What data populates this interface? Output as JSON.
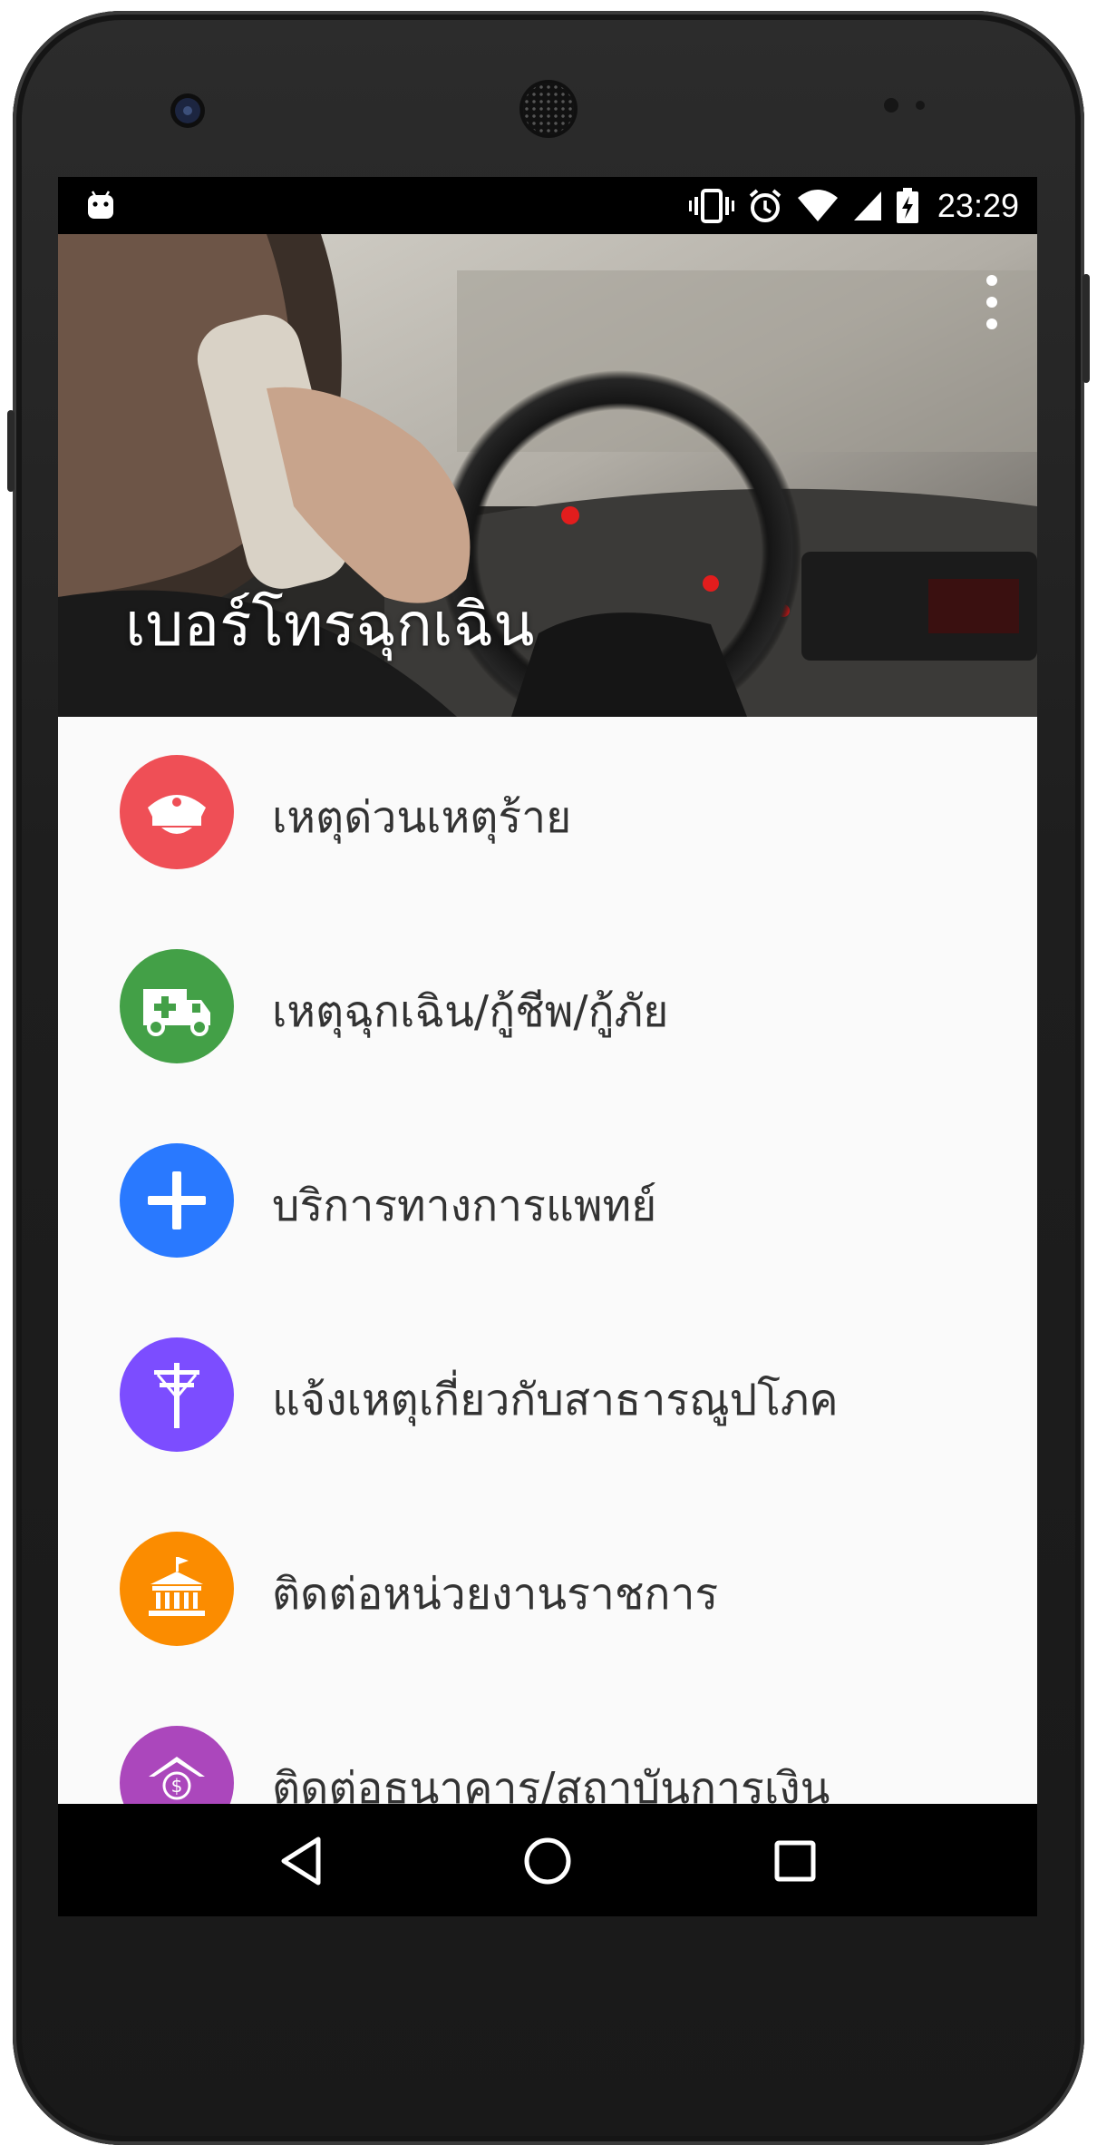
{
  "status_bar": {
    "time": "23:29",
    "icons": [
      "android-icon",
      "vibrate-icon",
      "alarm-icon",
      "wifi-icon",
      "cell-signal-icon",
      "battery-charging-icon"
    ]
  },
  "header": {
    "title": "เบอร์โทรฉุกเฉิน",
    "menu_icon": "overflow-menu-icon"
  },
  "categories": [
    {
      "label": "เหตุด่วนเหตุร้าย",
      "icon": "police-cap-icon",
      "color": "#ef4f56"
    },
    {
      "label": "เหตุฉุกเฉิน/กู้ชีพ/กู้ภัย",
      "icon": "ambulance-icon",
      "color": "#43a047"
    },
    {
      "label": "บริการทางการแพทย์",
      "icon": "medical-plus-icon",
      "color": "#2979ff"
    },
    {
      "label": "แจ้งเหตุเกี่ยวกับสาธารณูปโภค",
      "icon": "utility-pole-icon",
      "color": "#7c4dff"
    },
    {
      "label": "ติดต่อหน่วยงานราชการ",
      "icon": "government-building-icon",
      "color": "#fb8c00"
    },
    {
      "label": "ติดต่อธนาคาร/สถาบันการเงิน",
      "icon": "bank-icon",
      "color": "#ab47bc"
    }
  ],
  "nav_bar": {
    "icons": [
      "back-icon",
      "home-icon",
      "recents-icon"
    ]
  }
}
